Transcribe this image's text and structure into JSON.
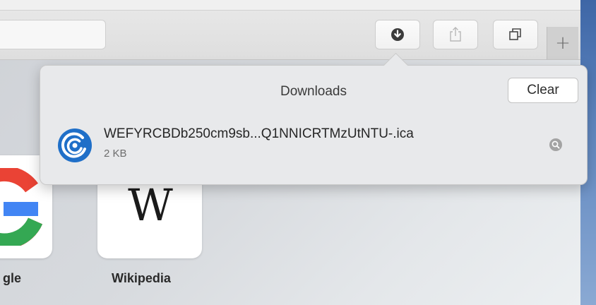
{
  "toolbar": {
    "buttons": [
      {
        "name": "downloads",
        "icon": "download-arrow-icon"
      },
      {
        "name": "share",
        "icon": "share-icon"
      },
      {
        "name": "tabs",
        "icon": "show-all-tabs-icon"
      }
    ],
    "new_tab_label": "+"
  },
  "downloads_popover": {
    "title": "Downloads",
    "clear_label": "Clear",
    "items": [
      {
        "file_name": "WEFYRCBDb250cm9sb...Q1NNICRTMzUtNTU-.ica",
        "size": "2 KB",
        "icon": "citrix-receiver-icon",
        "action_icon": "magnifier-reveal-icon"
      }
    ]
  },
  "favorites": [
    {
      "label": "gle",
      "icon": "google-logo"
    },
    {
      "label": "Wikipedia",
      "icon": "wikipedia-logo",
      "logo_text": "W"
    }
  ],
  "colors": {
    "citrix_blue": "#1f6fc8",
    "popover_bg": "#e8e9eb",
    "google_red": "#ea4335",
    "google_blue": "#4285f4",
    "google_green": "#34a853"
  }
}
